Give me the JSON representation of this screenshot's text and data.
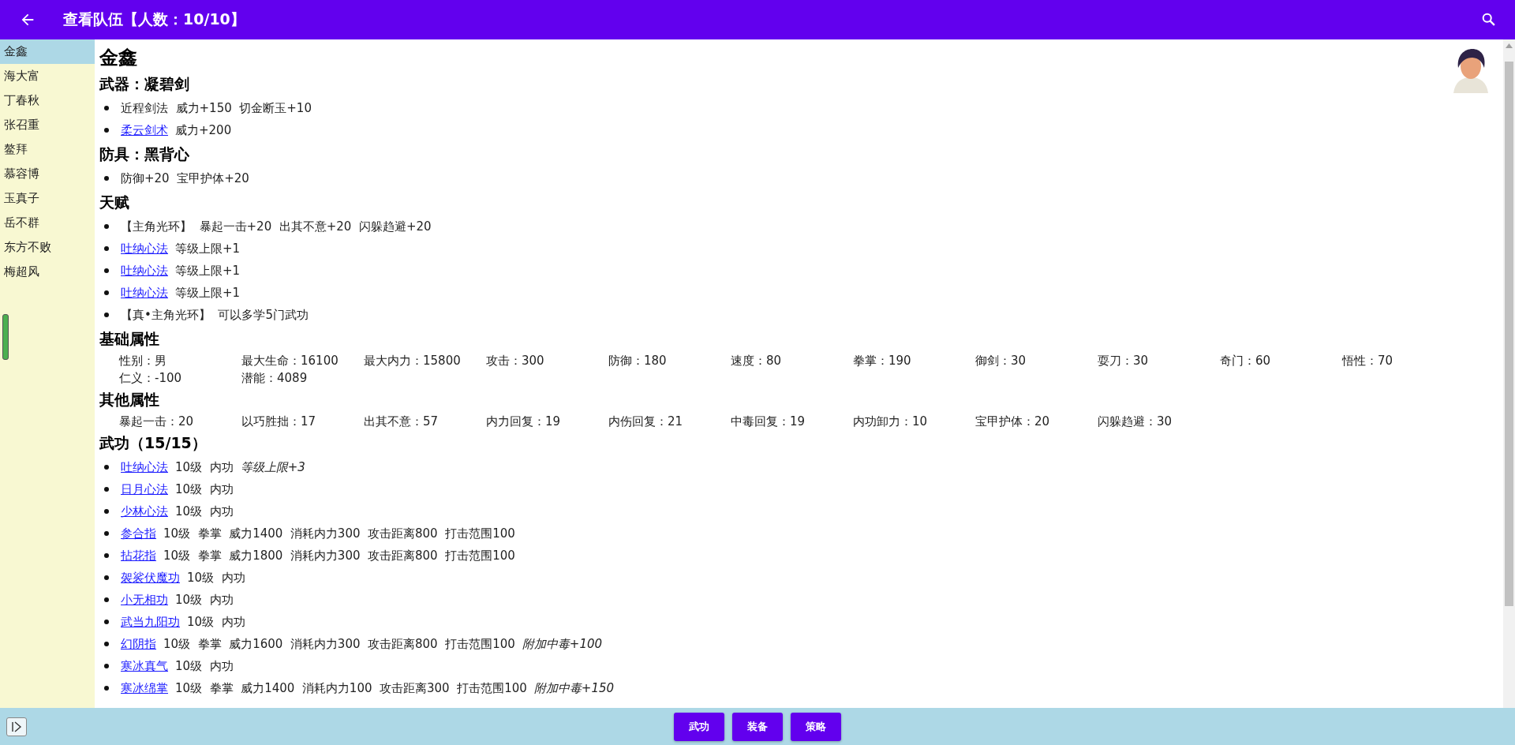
{
  "header": {
    "title": "查看队伍【人数：10/10】"
  },
  "sidebar": {
    "items": [
      {
        "label": "金鑫",
        "selected": true
      },
      {
        "label": "海大富",
        "selected": false
      },
      {
        "label": "丁春秋",
        "selected": false
      },
      {
        "label": "张召重",
        "selected": false
      },
      {
        "label": "鳌拜",
        "selected": false
      },
      {
        "label": "慕容博",
        "selected": false
      },
      {
        "label": "玉真子",
        "selected": false
      },
      {
        "label": "岳不群",
        "selected": false
      },
      {
        "label": "东方不败",
        "selected": false
      },
      {
        "label": "梅超风",
        "selected": false
      }
    ]
  },
  "character": {
    "name": "金鑫"
  },
  "sections": [
    {
      "kind": "list",
      "heading": "武器：凝碧剑",
      "items": [
        {
          "text": "近程剑法  威力+150  切金断玉+10"
        },
        {
          "link": "柔云剑术",
          "text": "威力+200"
        }
      ]
    },
    {
      "kind": "list",
      "heading": "防具：黑背心",
      "items": [
        {
          "text": "防御+20  宝甲护体+20"
        }
      ]
    },
    {
      "kind": "list",
      "heading": "天赋",
      "items": [
        {
          "text": "【主角光环】  暴起一击+20  出其不意+20  闪躲趋避+20"
        },
        {
          "link": "吐纳心法",
          "text": "等级上限+1"
        },
        {
          "link": "吐纳心法",
          "text": "等级上限+1"
        },
        {
          "link": "吐纳心法",
          "text": "等级上限+1"
        },
        {
          "text": "【真•主角光环】  可以多学5门武功"
        }
      ]
    },
    {
      "kind": "stats",
      "heading": "基础属性",
      "items": [
        "性别：男",
        "最大生命：16100",
        "最大内力：15800",
        "攻击：300",
        "防御：180",
        "速度：80",
        "拳掌：190",
        "御剑：30",
        "耍刀：30",
        "奇门：60",
        "悟性：70",
        "仁义：-100",
        "潜能：4089"
      ]
    },
    {
      "kind": "stats",
      "heading": "其他属性",
      "items": [
        "暴起一击：20",
        "以巧胜拙：17",
        "出其不意：57",
        "内力回复：19",
        "内伤回复：21",
        "中毒回复：19",
        "内功卸力：10",
        "宝甲护体：20",
        "闪躲趋避：30"
      ]
    },
    {
      "kind": "list",
      "heading": "武功（15/15）",
      "items": [
        {
          "link": "吐纳心法",
          "text": "10级  内功",
          "note": "等级上限+3"
        },
        {
          "link": "日月心法",
          "text": "10级  内功"
        },
        {
          "link": "少林心法",
          "text": "10级  内功"
        },
        {
          "link": "参合指",
          "text": "10级  拳掌  威力1400  消耗内力300  攻击距离800  打击范围100"
        },
        {
          "link": "拈花指",
          "text": "10级  拳掌  威力1800  消耗内力300  攻击距离800  打击范围100"
        },
        {
          "link": "袈裟伏魔功",
          "text": "10级  内功"
        },
        {
          "link": "小无相功",
          "text": "10级  内功"
        },
        {
          "link": "武当九阳功",
          "text": "10级  内功"
        },
        {
          "link": "幻阴指",
          "text": "10级  拳掌  威力1600  消耗内力300  攻击距离800  打击范围100",
          "note": "附加中毒+100"
        },
        {
          "link": "寒冰真气",
          "text": "10级  内功"
        },
        {
          "link": "寒冰绵掌",
          "text": "10级  拳掌  威力1400  消耗内力100  攻击距离300  打击范围100",
          "note": "附加中毒+150"
        }
      ]
    }
  ],
  "footer": {
    "buttons": [
      "武功",
      "装备",
      "策略"
    ]
  }
}
